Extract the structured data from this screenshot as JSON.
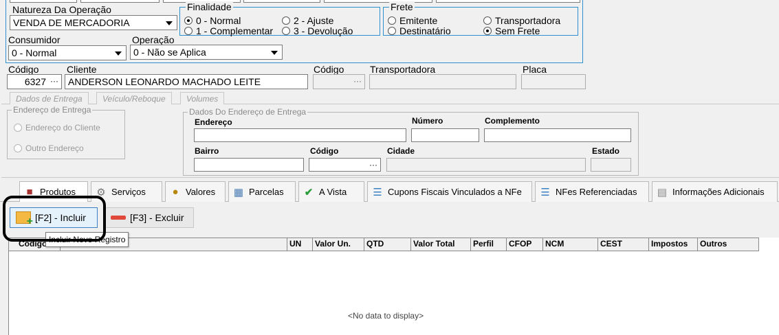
{
  "operacao": {
    "natureza_label": "Natureza Da Operação",
    "natureza_value": "VENDA DE MERCADORIA",
    "consumidor_label": "Consumidor",
    "consumidor_value": "0 - Normal",
    "operacao_label": "Operação",
    "operacao_value": "0 - Não se Aplica"
  },
  "finalidade": {
    "title": "Finalidade",
    "options": [
      {
        "label": "0 - Normal",
        "selected": true
      },
      {
        "label": "1 - Complementar",
        "selected": false
      },
      {
        "label": "2 - Ajuste",
        "selected": false
      },
      {
        "label": "3 - Devolução",
        "selected": false
      }
    ]
  },
  "frete": {
    "title": "Frete",
    "options": [
      {
        "label": "Emitente",
        "selected": false
      },
      {
        "label": "Destinatário",
        "selected": false
      },
      {
        "label": "Transportadora",
        "selected": false
      },
      {
        "label": "Sem Frete",
        "selected": true
      }
    ]
  },
  "cliente": {
    "codigo_label": "Código",
    "codigo_value": "6327",
    "cliente_label": "Cliente",
    "cliente_value": "ANDERSON LEONARDO MACHADO LEITE",
    "ellipsis": "···"
  },
  "transporte": {
    "codigo_label": "Código",
    "transportadora_label": "Transportadora",
    "placa_label": "Placa",
    "ellipsis": "···"
  },
  "entrega_tabs": [
    "Dados de Entrega",
    "Veículo/Reboque",
    "Volumes"
  ],
  "endereco_entrega": {
    "title": "Endereço de Entrega",
    "options": [
      {
        "label": "Endereço do Cliente"
      },
      {
        "label": "Outro Endereço"
      }
    ]
  },
  "dados_endereco": {
    "title": "Dados Do Endereço de Entrega",
    "endereco_label": "Endereço",
    "numero_label": "Número",
    "complemento_label": "Complemento",
    "bairro_label": "Bairro",
    "codigo_label": "Código",
    "cidade_label": "Cidade",
    "estado_label": "Estado",
    "ellipsis": "···"
  },
  "bottom_tabs": [
    {
      "label": "Produtos",
      "icon": "box-icon"
    },
    {
      "label": "Serviços",
      "icon": "gear-icon"
    },
    {
      "label": "Valores",
      "icon": "money-bag-icon"
    },
    {
      "label": "Parcelas",
      "icon": "grid-icon"
    },
    {
      "label": "A Vista",
      "icon": "check-icon"
    },
    {
      "label": "Cupons Fiscais Vinculados a NFe",
      "icon": "list-icon"
    },
    {
      "label": "NFes Referenciadas",
      "icon": "list-icon"
    },
    {
      "label": "Informações Adicionais",
      "icon": "document-icon"
    }
  ],
  "toolbar": {
    "incluir_label": "[F2] - Incluir",
    "excluir_label": "[F3] - Excluir",
    "tooltip": "Incluir Novo Registro"
  },
  "grid": {
    "columns": [
      "Código",
      "",
      "UN",
      "Valor Un.",
      "QTD",
      "Valor Total",
      "Perfil",
      "CFOP",
      "NCM",
      "CEST",
      "Impostos",
      "Outros"
    ],
    "empty_text": "<No data to display>"
  },
  "colors": {
    "group_border": "#2e8fd0",
    "highlight": "#000000"
  }
}
